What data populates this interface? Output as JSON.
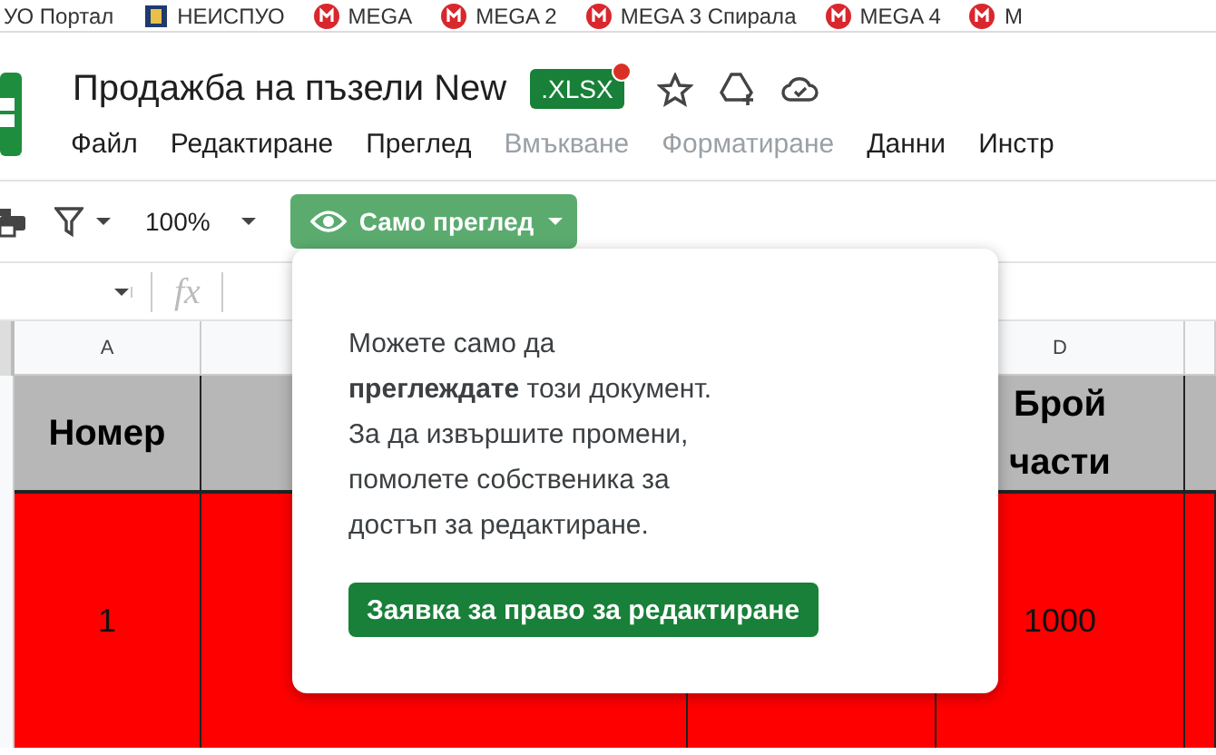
{
  "bookmarks": [
    {
      "label": "УО Портал",
      "kind": "plain"
    },
    {
      "label": "НЕИСПУО",
      "kind": "book"
    },
    {
      "label": "MEGA",
      "kind": "mega"
    },
    {
      "label": "MEGA 2",
      "kind": "mega"
    },
    {
      "label": "MEGA 3 Спирала",
      "kind": "mega"
    },
    {
      "label": "MEGA 4",
      "kind": "mega"
    },
    {
      "label": "M",
      "kind": "mega"
    }
  ],
  "document": {
    "title": "Продажба на пъзели New",
    "format_badge": ".XLSX",
    "notification": true
  },
  "menu": [
    {
      "label": "Файл",
      "disabled": false
    },
    {
      "label": "Редактиране",
      "disabled": false
    },
    {
      "label": "Преглед",
      "disabled": false
    },
    {
      "label": "Вмъкване",
      "disabled": true
    },
    {
      "label": "Форматиране",
      "disabled": true
    },
    {
      "label": "Данни",
      "disabled": false
    },
    {
      "label": "Инстр",
      "disabled": false
    }
  ],
  "toolbar": {
    "zoom": "100%",
    "mode_button": "Само преглед"
  },
  "formula_bar": {
    "fx": "fx"
  },
  "columns": [
    {
      "letter": "A",
      "heading": "Номер",
      "value": "1"
    },
    {},
    {},
    {
      "letter": "D",
      "heading": "Брой части",
      "value": "1000"
    },
    {}
  ],
  "popup": {
    "message": "Можете само да\n**преглеждате** този документ.\nЗа да извършите промени,\nпомолете собственика за\nдостъп за редактиране.",
    "button": "Заявка за право за редактиране"
  }
}
